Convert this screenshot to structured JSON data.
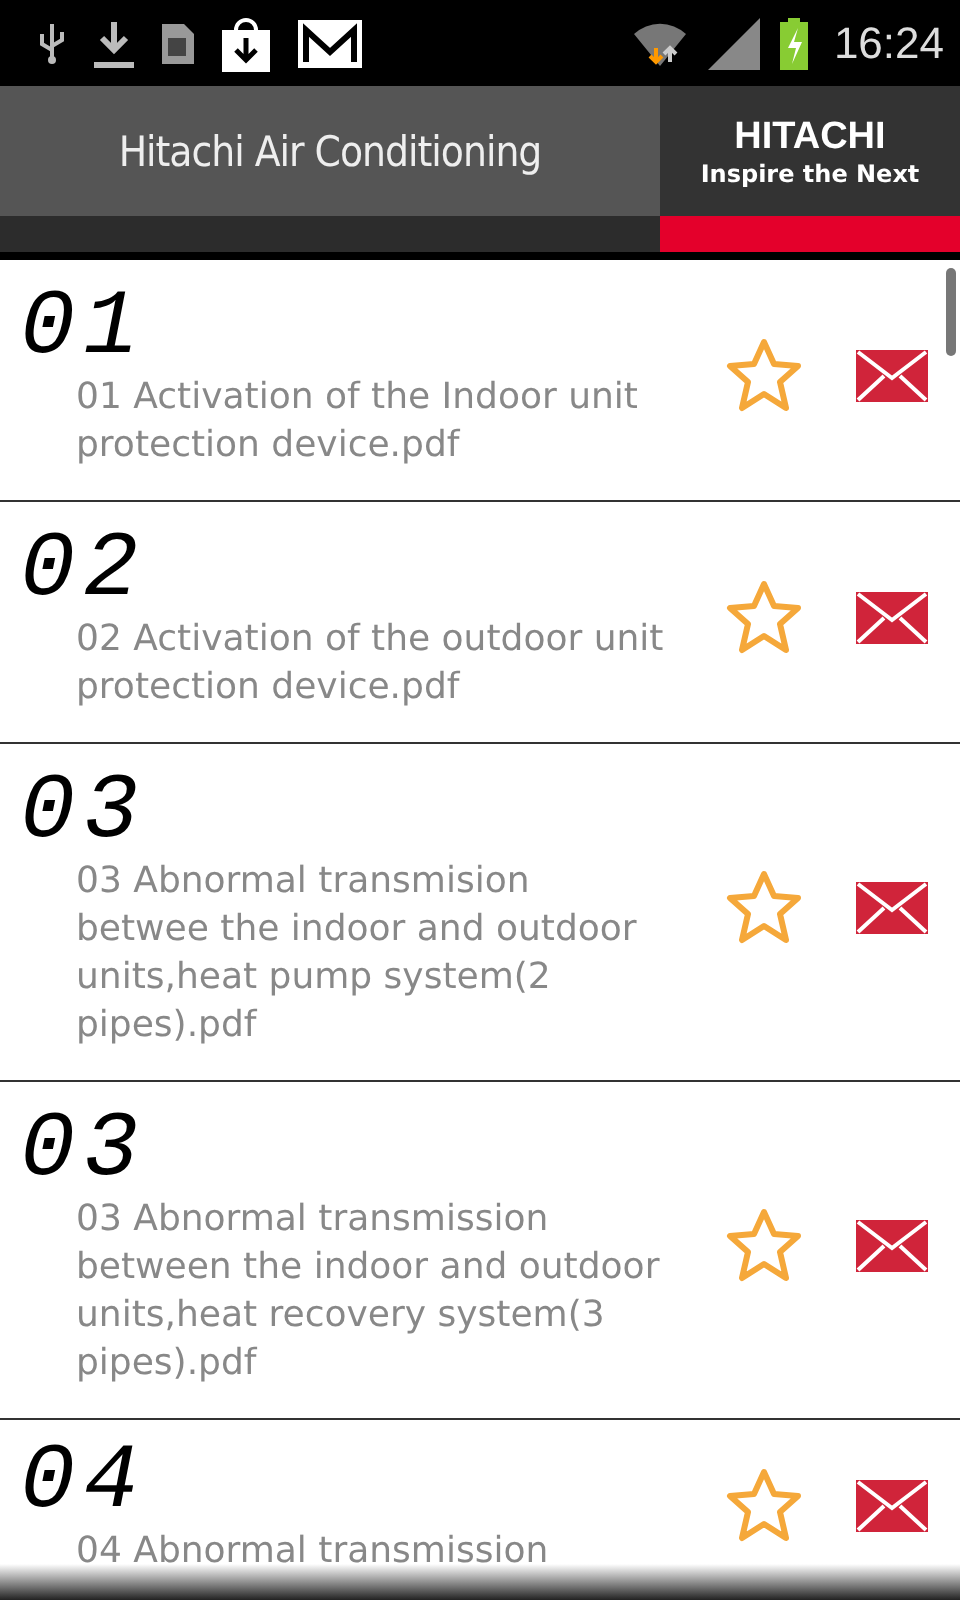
{
  "status_bar": {
    "time": "16:24"
  },
  "header": {
    "title": "Hitachi Air Conditioning",
    "logo": {
      "brand": "HITACHI",
      "tagline": "Inspire the Next"
    }
  },
  "documents": [
    {
      "code": "01",
      "title": "01 Activation of the Indoor unit protection device.pdf"
    },
    {
      "code": "02",
      "title": "02 Activation of the outdoor unit protection device.pdf"
    },
    {
      "code": "03",
      "title": "03 Abnormal transmision betwee the indoor and outdoor units,heat pump system(2 pipes).pdf"
    },
    {
      "code": "03",
      "title": "03 Abnormal transmission between the indoor and outdoor units,heat recovery system(3 pipes).pdf"
    },
    {
      "code": "04",
      "title": "04 Abnormal transmission"
    }
  ]
}
